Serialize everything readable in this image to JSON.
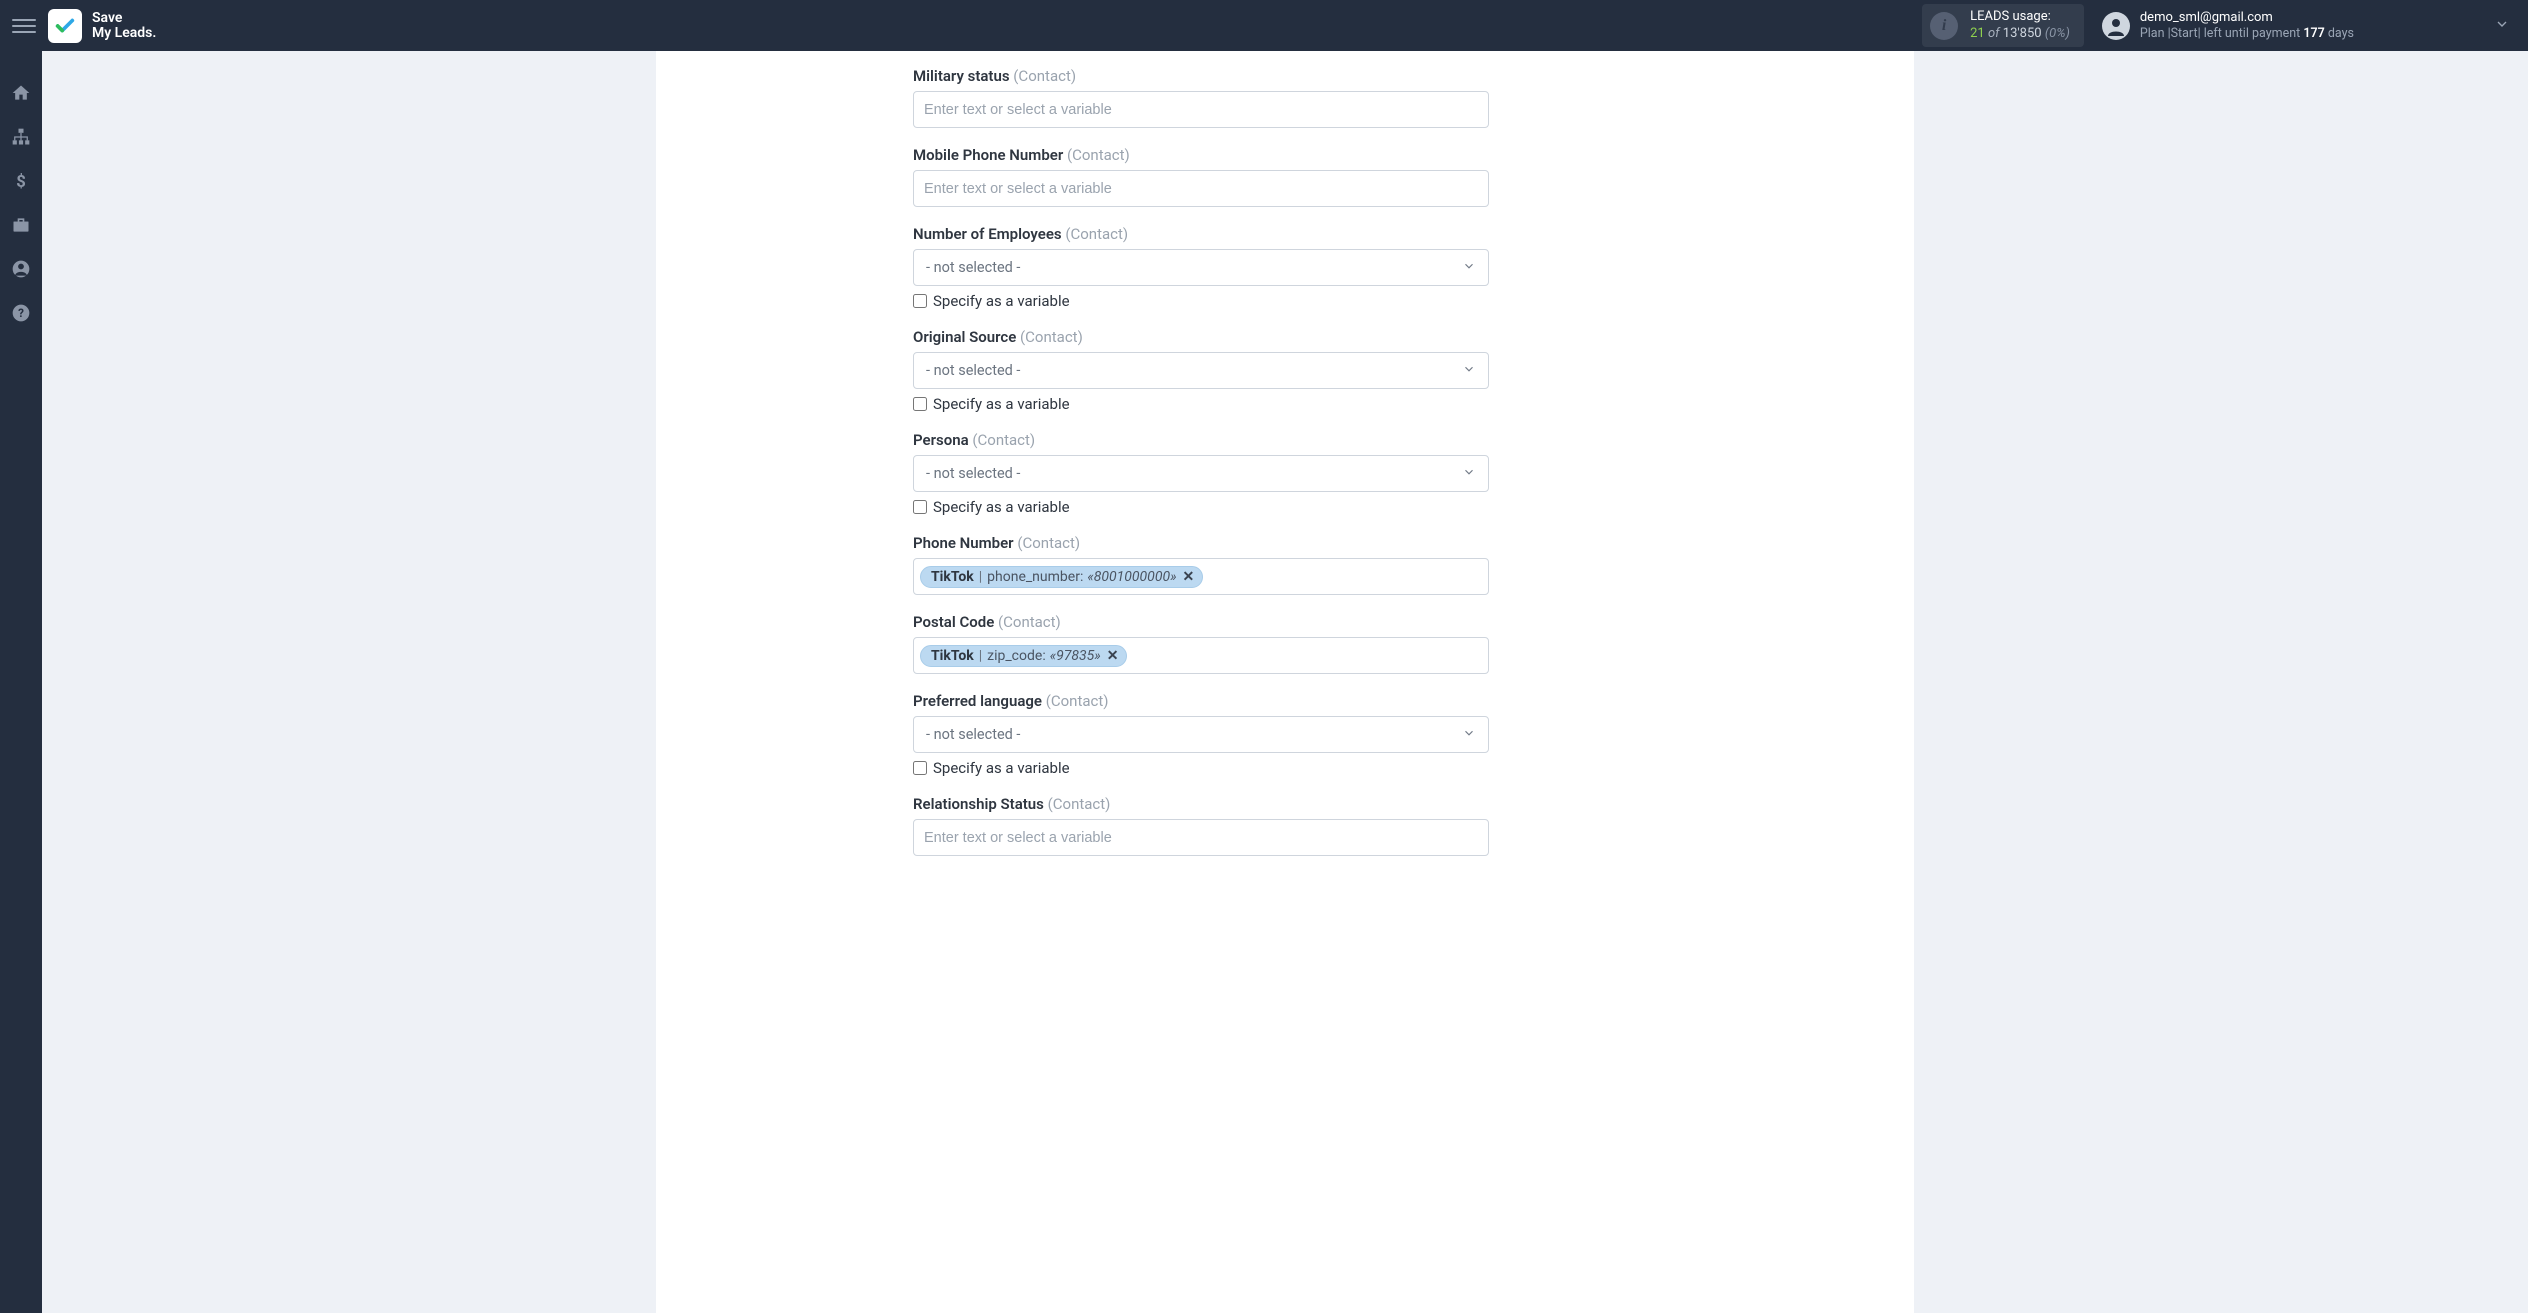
{
  "brand": {
    "line1": "Save",
    "line2": "My Leads."
  },
  "header": {
    "usage_label": "LEADS usage:",
    "usage_used": "21",
    "usage_of": "of",
    "usage_total": "13'850",
    "usage_pct": "(0%)",
    "user_email": "demo_sml@gmail.com",
    "plan_prefix": "Plan |Start| left until payment",
    "plan_days": "177",
    "plan_suffix": "days"
  },
  "common": {
    "placeholder_text": "Enter text or select a variable",
    "not_selected": "- not selected -",
    "specify_variable": "Specify as a variable",
    "contact_hint": "(Contact)"
  },
  "fields": {
    "military_status": {
      "label": "Military status"
    },
    "mobile_phone": {
      "label": "Mobile Phone Number"
    },
    "num_employees": {
      "label": "Number of Employees"
    },
    "original_source": {
      "label": "Original Source"
    },
    "persona": {
      "label": "Persona"
    },
    "phone_number": {
      "label": "Phone Number",
      "token_source": "TikTok",
      "token_key": "phone_number:",
      "token_value": "«8001000000»"
    },
    "postal_code": {
      "label": "Postal Code",
      "token_source": "TikTok",
      "token_key": "zip_code:",
      "token_value": "«97835»"
    },
    "preferred_language": {
      "label": "Preferred language"
    },
    "relationship_status": {
      "label": "Relationship Status"
    }
  }
}
